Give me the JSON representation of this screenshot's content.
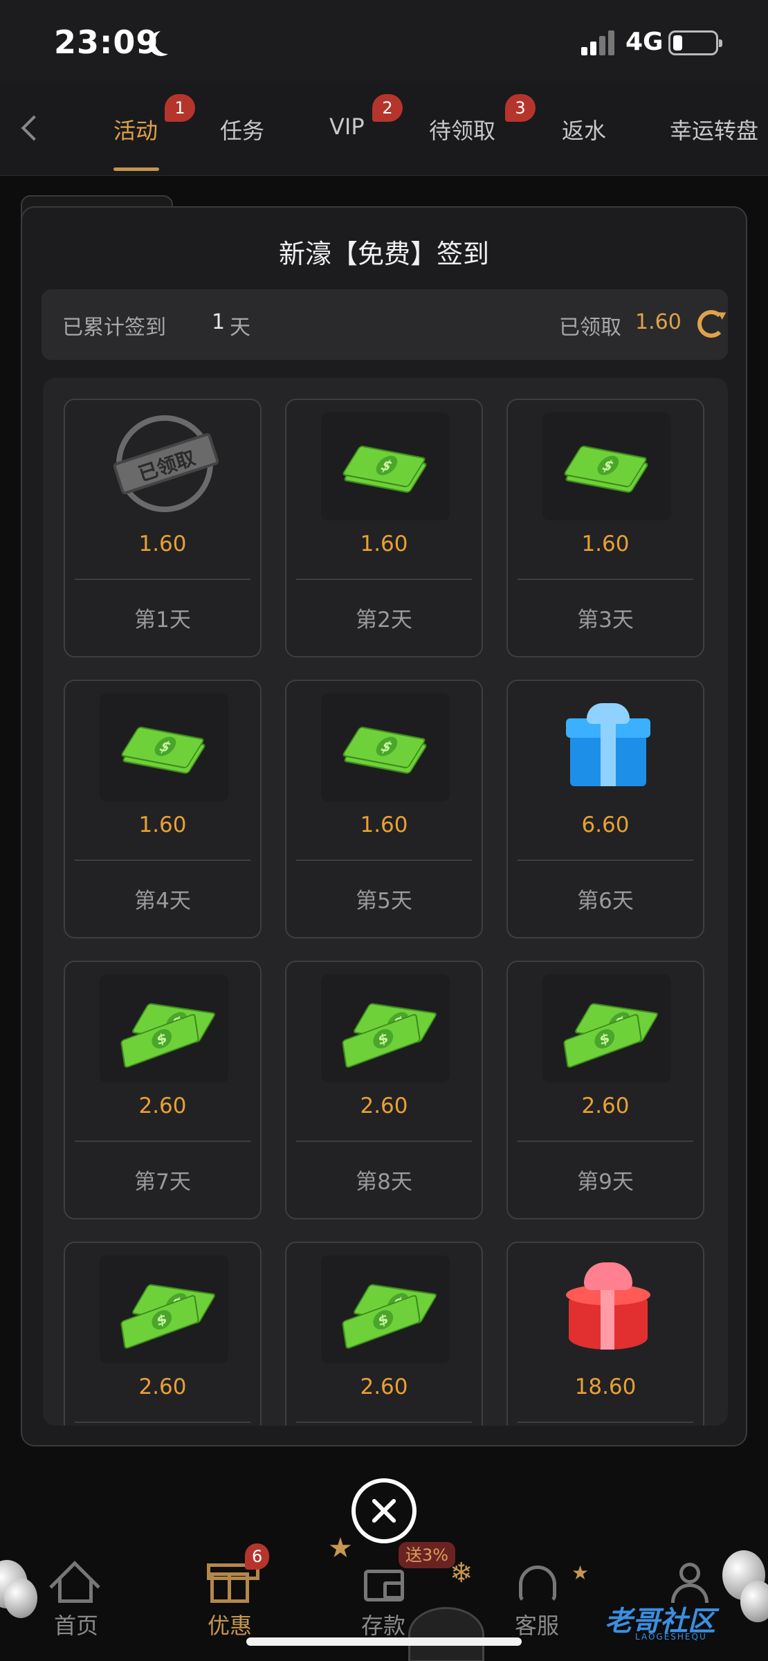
{
  "status_bar": {
    "time": "23:09",
    "network": "4G"
  },
  "tabs": [
    {
      "label": "活动",
      "badge": "1",
      "active": true
    },
    {
      "label": "任务",
      "badge": ""
    },
    {
      "label": "VIP",
      "badge": "2"
    },
    {
      "label": "待领取",
      "badge": "3"
    },
    {
      "label": "返水",
      "badge": ""
    },
    {
      "label": "幸运转盘",
      "badge": ""
    }
  ],
  "modal": {
    "title": "新濠【免费】签到",
    "summary": {
      "days_label": "已累计签到",
      "days_value": "1",
      "days_unit": "天",
      "claimed_label": "已领取",
      "claimed_value": "1.60"
    },
    "days": [
      {
        "amount": "1.60",
        "label": "第1天",
        "icon": "claimed-stamp-icon",
        "stamp_text": "已领取"
      },
      {
        "amount": "1.60",
        "label": "第2天",
        "icon": "money-stack-icon"
      },
      {
        "amount": "1.60",
        "label": "第3天",
        "icon": "money-stack-icon"
      },
      {
        "amount": "1.60",
        "label": "第4天",
        "icon": "money-stack-icon"
      },
      {
        "amount": "1.60",
        "label": "第5天",
        "icon": "money-stack-icon"
      },
      {
        "amount": "6.60",
        "label": "第6天",
        "icon": "blue-gift-icon"
      },
      {
        "amount": "2.60",
        "label": "第7天",
        "icon": "money-fan-icon"
      },
      {
        "amount": "2.60",
        "label": "第8天",
        "icon": "money-fan-icon"
      },
      {
        "amount": "2.60",
        "label": "第9天",
        "icon": "money-fan-icon"
      },
      {
        "amount": "2.60",
        "label": "",
        "icon": "money-fan-icon"
      },
      {
        "amount": "2.60",
        "label": "",
        "icon": "money-fan-icon"
      },
      {
        "amount": "18.60",
        "label": "",
        "icon": "red-gift-icon"
      }
    ]
  },
  "bottom_nav": [
    {
      "label": "首页",
      "icon": "home-icon",
      "badge": ""
    },
    {
      "label": "优惠",
      "icon": "gift-icon",
      "badge": "6",
      "active": true
    },
    {
      "label": "存款",
      "icon": "wallet-icon",
      "badge": "送3%"
    },
    {
      "label": "客服",
      "icon": "headset-icon",
      "badge": ""
    },
    {
      "label": "",
      "icon": "profile-icon",
      "badge": ""
    }
  ],
  "watermark": {
    "text": "老哥社区",
    "sub": "LAOGESHEQU"
  },
  "colors": {
    "accent": "#e0a24a",
    "badge": "#b5352c",
    "amount": "#e8a134"
  }
}
